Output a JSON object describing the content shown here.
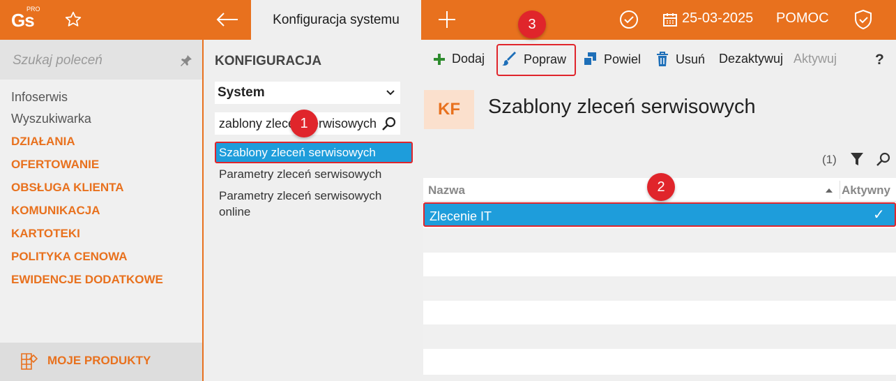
{
  "app": {
    "logo": "Gs",
    "logo_pro": "PRO",
    "active_tab": "Konfiguracja systemu",
    "date": "25-03-2025",
    "help": "POMOC"
  },
  "sidebar": {
    "search_placeholder": "Szukaj poleceń",
    "items": [
      "Infoserwis",
      "Wyszukiwarka"
    ],
    "sections": [
      "DZIAŁANIA",
      "OFERTOWANIE",
      "OBSŁUGA KLIENTA",
      "KOMUNIKACJA",
      "KARTOTEKI",
      "POLITYKA CENOWA",
      "EWIDENCJE DODATKOWE"
    ],
    "bottom": "MOJE PRODUKTY"
  },
  "config_panel": {
    "title": "KONFIGURACJA",
    "select_value": "System",
    "search_value": "zablony zleceń serwisowych",
    "items": [
      "Szablony zleceń serwisowych",
      "Parametry zleceń serwisowych",
      "Parametry zleceń serwisowych online"
    ]
  },
  "toolbar": {
    "add": "Dodaj",
    "edit": "Popraw",
    "duplicate": "Powiel",
    "delete": "Usuń",
    "deactivate": "Dezaktywuj",
    "activate": "Aktywuj",
    "help": "?"
  },
  "content": {
    "badge": "KF",
    "title": "Szablony zleceń serwisowych",
    "count": "(1)",
    "columns": [
      "Nazwa",
      "Aktywny"
    ],
    "rows": [
      {
        "name": "Zlecenie IT",
        "active": "✓"
      }
    ]
  },
  "annotations": [
    "1",
    "2",
    "3"
  ],
  "colors": {
    "accent": "#e8711e",
    "selection": "#1e9ddb",
    "highlight": "#e0252b"
  }
}
